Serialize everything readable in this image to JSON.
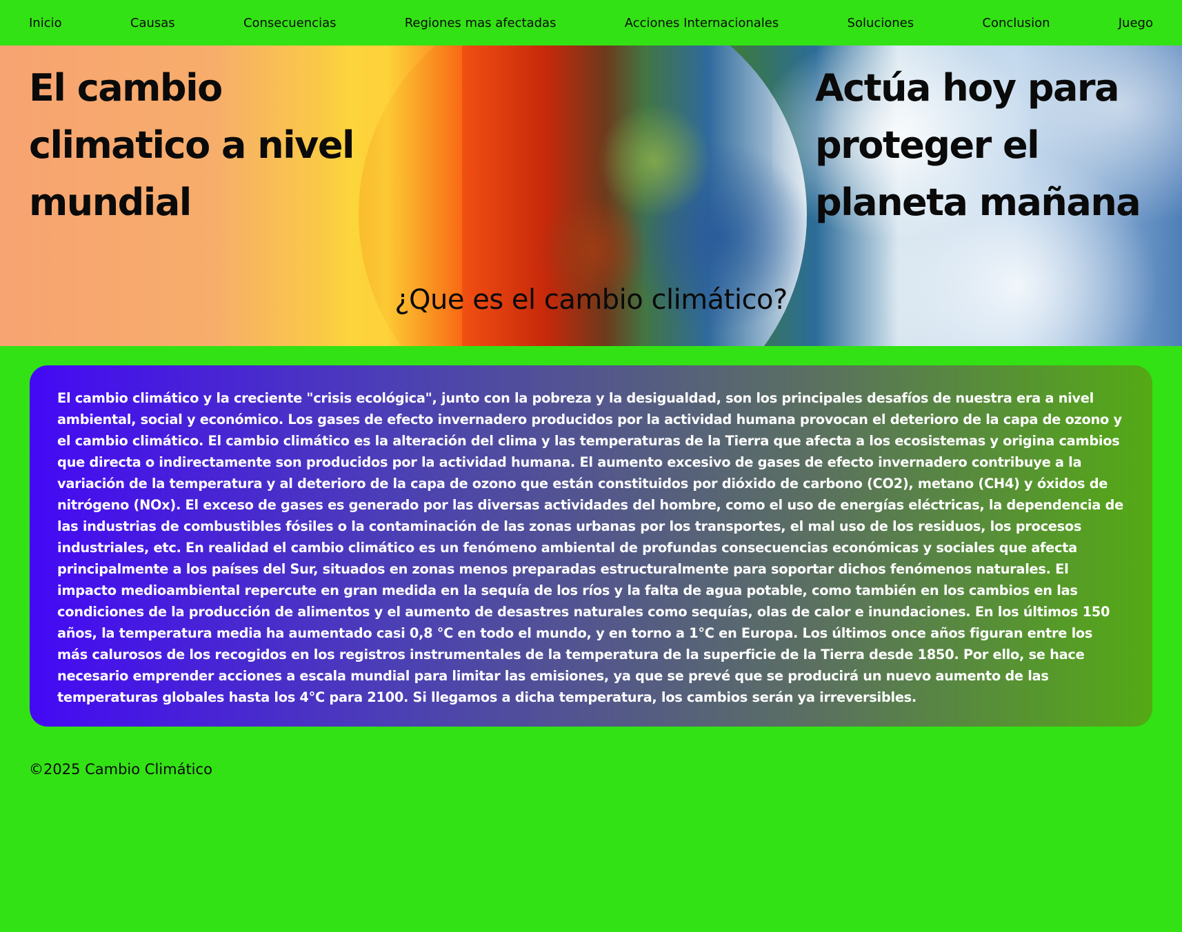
{
  "nav": {
    "items": [
      {
        "label": "Inicio"
      },
      {
        "label": "Causas"
      },
      {
        "label": "Consecuencias"
      },
      {
        "label": "Regiones mas afectadas"
      },
      {
        "label": "Acciones Internacionales"
      },
      {
        "label": "Soluciones"
      },
      {
        "label": "Conclusion"
      },
      {
        "label": "Juego"
      }
    ]
  },
  "hero": {
    "left_title": "El cambio climatico a nivel mundial",
    "right_title": "Actúa hoy para proteger el planeta mañana",
    "question": "¿Que es el cambio climático?",
    "image": "earth-half-burning-half-clouds"
  },
  "content": {
    "paragraph": "El cambio climático y la creciente \"crisis ecológica\", junto con la pobreza y la desigualdad, son los principales desafíos de nuestra era a nivel ambiental, social y económico. Los gases de efecto invernadero producidos por la actividad humana provocan el deterioro de la capa de ozono y el cambio climático. El cambio climático es la alteración del clima y las temperaturas de la Tierra que afecta a los ecosistemas y origina cambios que directa o indirectamente son producidos por la actividad humana. El aumento excesivo de gases de efecto invernadero contribuye a la variación de la temperatura y al deterioro de la capa de ozono que están constituidos por dióxido de carbono (CO2), metano (CH4) y óxidos de nitrógeno (NOx). El exceso de gases es generado por las diversas actividades del hombre, como el uso de energías eléctricas, la dependencia de las industrias de combustibles fósiles o la contaminación de las zonas urbanas por los transportes, el mal uso de los residuos, los procesos industriales, etc. En realidad el cambio climático es un fenómeno ambiental de profundas consecuencias económicas y sociales que afecta principalmente a los países del Sur, situados en zonas menos preparadas estructuralmente para soportar dichos fenómenos naturales. El impacto medioambiental repercute en gran medida en la sequía de los ríos y la falta de agua potable, como también en los cambios en las condiciones de la producción de alimentos y el aumento de desastres naturales como sequías, olas de calor e inundaciones. En los últimos 150 años, la temperatura media ha aumentado casi 0,8 °C en todo el mundo, y en torno a 1°C en Europa. Los últimos once años figuran entre los más calurosos de los recogidos en los registros instrumentales de la temperatura de la superficie de la Tierra desde 1850. Por ello, se hace necesario emprender acciones a escala mundial para limitar las emisiones, ya que se prevé que se producirá un nuevo aumento de las temperaturas globales hasta los 4°C para 2100. Si llegamos a dicha temperatura, los cambios serán ya irreversibles."
  },
  "footer": {
    "text": "©2025 Cambio Climático"
  },
  "colors": {
    "page_background": "#33e214",
    "box_gradient_start": "#4409f5",
    "box_gradient_end": "#54aa14",
    "text_dark": "#0a0a0a",
    "text_light": "#ffffff"
  }
}
